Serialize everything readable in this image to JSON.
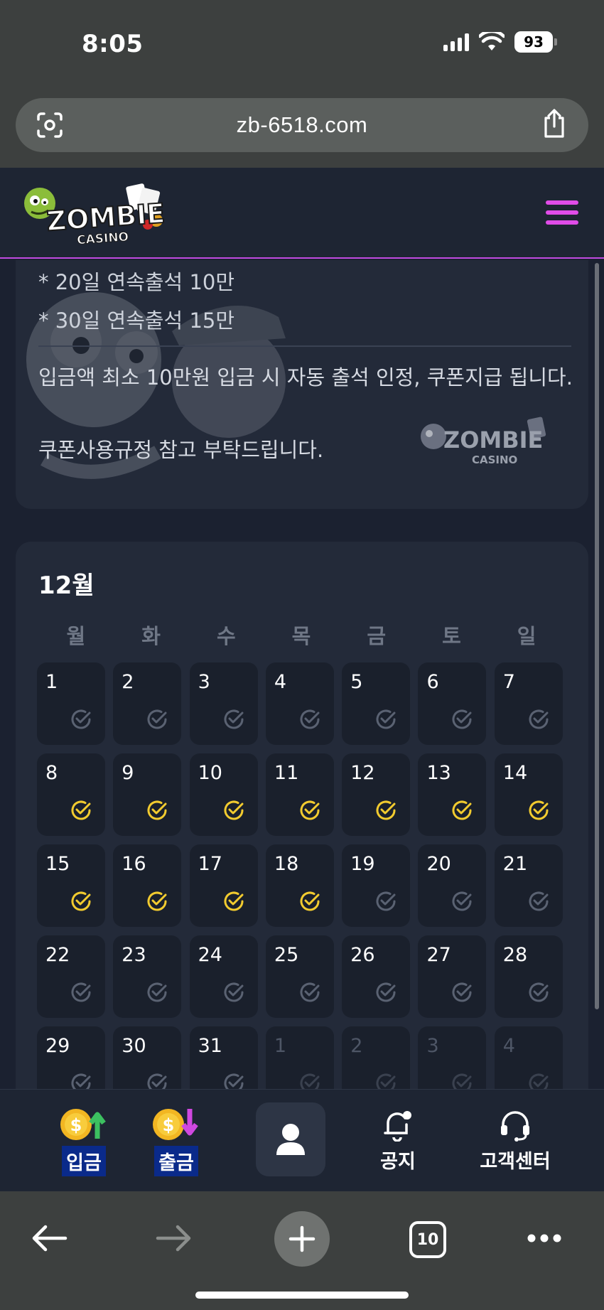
{
  "status_bar": {
    "time": "8:05",
    "battery": "93"
  },
  "browser": {
    "url": "zb-6518.com",
    "tab_count": "10"
  },
  "site": {
    "logo_text": "ZOMBIE",
    "logo_sub": "CASINO"
  },
  "info": {
    "line_20": "* 20일 연속출석 10만",
    "line_30": "* 30일 연속출석 15만",
    "paragraph_1": "입금액 최소 10만원 입금 시 자동 출석 인정, 쿠폰지급 됩니다.",
    "paragraph_2": "쿠폰사용규정 참고 부탁드립니다."
  },
  "calendar": {
    "month": "12월",
    "weekdays": [
      "월",
      "화",
      "수",
      "목",
      "금",
      "토",
      "일"
    ],
    "days": [
      {
        "day": "1",
        "checked": false,
        "outside": false
      },
      {
        "day": "2",
        "checked": false,
        "outside": false
      },
      {
        "day": "3",
        "checked": false,
        "outside": false
      },
      {
        "day": "4",
        "checked": false,
        "outside": false
      },
      {
        "day": "5",
        "checked": false,
        "outside": false
      },
      {
        "day": "6",
        "checked": false,
        "outside": false
      },
      {
        "day": "7",
        "checked": false,
        "outside": false
      },
      {
        "day": "8",
        "checked": true,
        "outside": false
      },
      {
        "day": "9",
        "checked": true,
        "outside": false
      },
      {
        "day": "10",
        "checked": true,
        "outside": false
      },
      {
        "day": "11",
        "checked": true,
        "outside": false
      },
      {
        "day": "12",
        "checked": true,
        "outside": false
      },
      {
        "day": "13",
        "checked": true,
        "outside": false
      },
      {
        "day": "14",
        "checked": true,
        "outside": false
      },
      {
        "day": "15",
        "checked": true,
        "outside": false
      },
      {
        "day": "16",
        "checked": true,
        "outside": false
      },
      {
        "day": "17",
        "checked": true,
        "outside": false
      },
      {
        "day": "18",
        "checked": true,
        "outside": false
      },
      {
        "day": "19",
        "checked": false,
        "outside": false
      },
      {
        "day": "20",
        "checked": false,
        "outside": false
      },
      {
        "day": "21",
        "checked": false,
        "outside": false
      },
      {
        "day": "22",
        "checked": false,
        "outside": false
      },
      {
        "day": "23",
        "checked": false,
        "outside": false
      },
      {
        "day": "24",
        "checked": false,
        "outside": false
      },
      {
        "day": "25",
        "checked": false,
        "outside": false
      },
      {
        "day": "26",
        "checked": false,
        "outside": false
      },
      {
        "day": "27",
        "checked": false,
        "outside": false
      },
      {
        "day": "28",
        "checked": false,
        "outside": false
      },
      {
        "day": "29",
        "checked": false,
        "outside": false
      },
      {
        "day": "30",
        "checked": false,
        "outside": false
      },
      {
        "day": "31",
        "checked": false,
        "outside": false
      },
      {
        "day": "1",
        "checked": false,
        "outside": true
      },
      {
        "day": "2",
        "checked": false,
        "outside": true
      },
      {
        "day": "3",
        "checked": false,
        "outside": true
      },
      {
        "day": "4",
        "checked": false,
        "outside": true
      }
    ]
  },
  "bottom_nav": {
    "deposit": "입금",
    "withdraw": "출금",
    "notice": "공지",
    "support": "고객센터"
  },
  "colors": {
    "accent_magenta": "#e04ce8",
    "check_gold": "#f2cb2f",
    "check_gray": "#5a6272",
    "card_bg": "#232a39",
    "cell_bg": "#1a202c"
  }
}
